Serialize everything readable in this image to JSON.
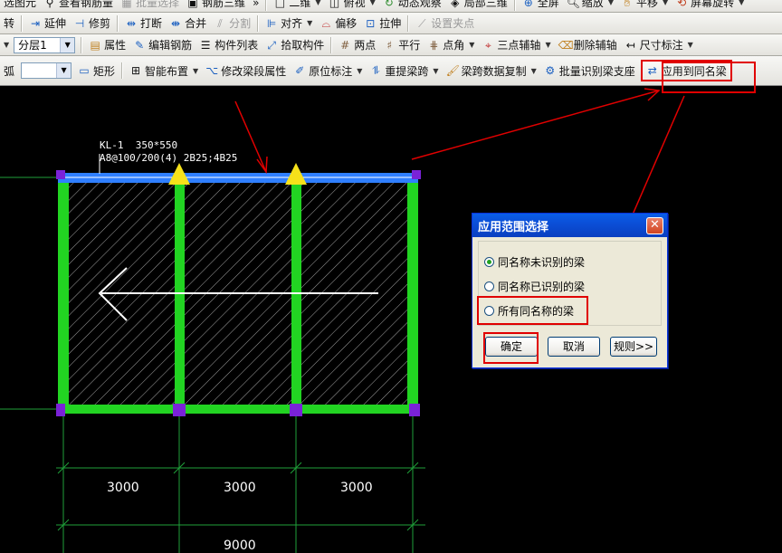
{
  "toolbar1": {
    "items": [
      "选图元",
      "查看钢筋量",
      "批量选择",
      "钢筋三维",
      "»",
      "二维",
      "俯视",
      "动态观察",
      "局部三维",
      "全屏",
      "缩放",
      "平移",
      "屏幕旋转"
    ]
  },
  "toolbar2": {
    "items": [
      "转",
      "延伸",
      "修剪",
      "打断",
      "合并",
      "分割",
      "对齐",
      "偏移",
      "拉伸",
      "设置夹点"
    ]
  },
  "toolbar3": {
    "floor_value": "分层1",
    "items": [
      "属性",
      "编辑钢筋",
      "构件列表",
      "拾取构件",
      "两点",
      "平行",
      "点角",
      "三点辅轴",
      "删除辅轴",
      "尺寸标注"
    ]
  },
  "toolbar4": {
    "items": [
      "弧",
      "矩形",
      "智能布置",
      "修改梁段属性",
      "原位标注",
      "重提梁跨",
      "梁跨数据复制",
      "批量识别梁支座",
      "应用到同名梁"
    ]
  },
  "drawing": {
    "beam_name": "KL-1  350*550",
    "beam_rebar": "A8@100/200(4) 2B25;4B25",
    "dims": [
      "3000",
      "3000",
      "3000"
    ],
    "total_dim": "9000"
  },
  "dialog": {
    "title": "应用范围选择",
    "options": [
      {
        "label": "同名称未识别的梁",
        "checked": true
      },
      {
        "label": "同名称已识别的梁",
        "checked": false
      },
      {
        "label": "所有同名称的梁",
        "checked": false
      }
    ],
    "ok": "确定",
    "cancel": "取消",
    "rules": "规则>>"
  },
  "colors": {
    "beam_blue": "#2f7fff",
    "column_green": "#22d422",
    "node_purple": "#7a22d8",
    "marker_yellow": "#f6e11a",
    "annot_red": "#e00000",
    "grid_green": "#1fa03a"
  }
}
